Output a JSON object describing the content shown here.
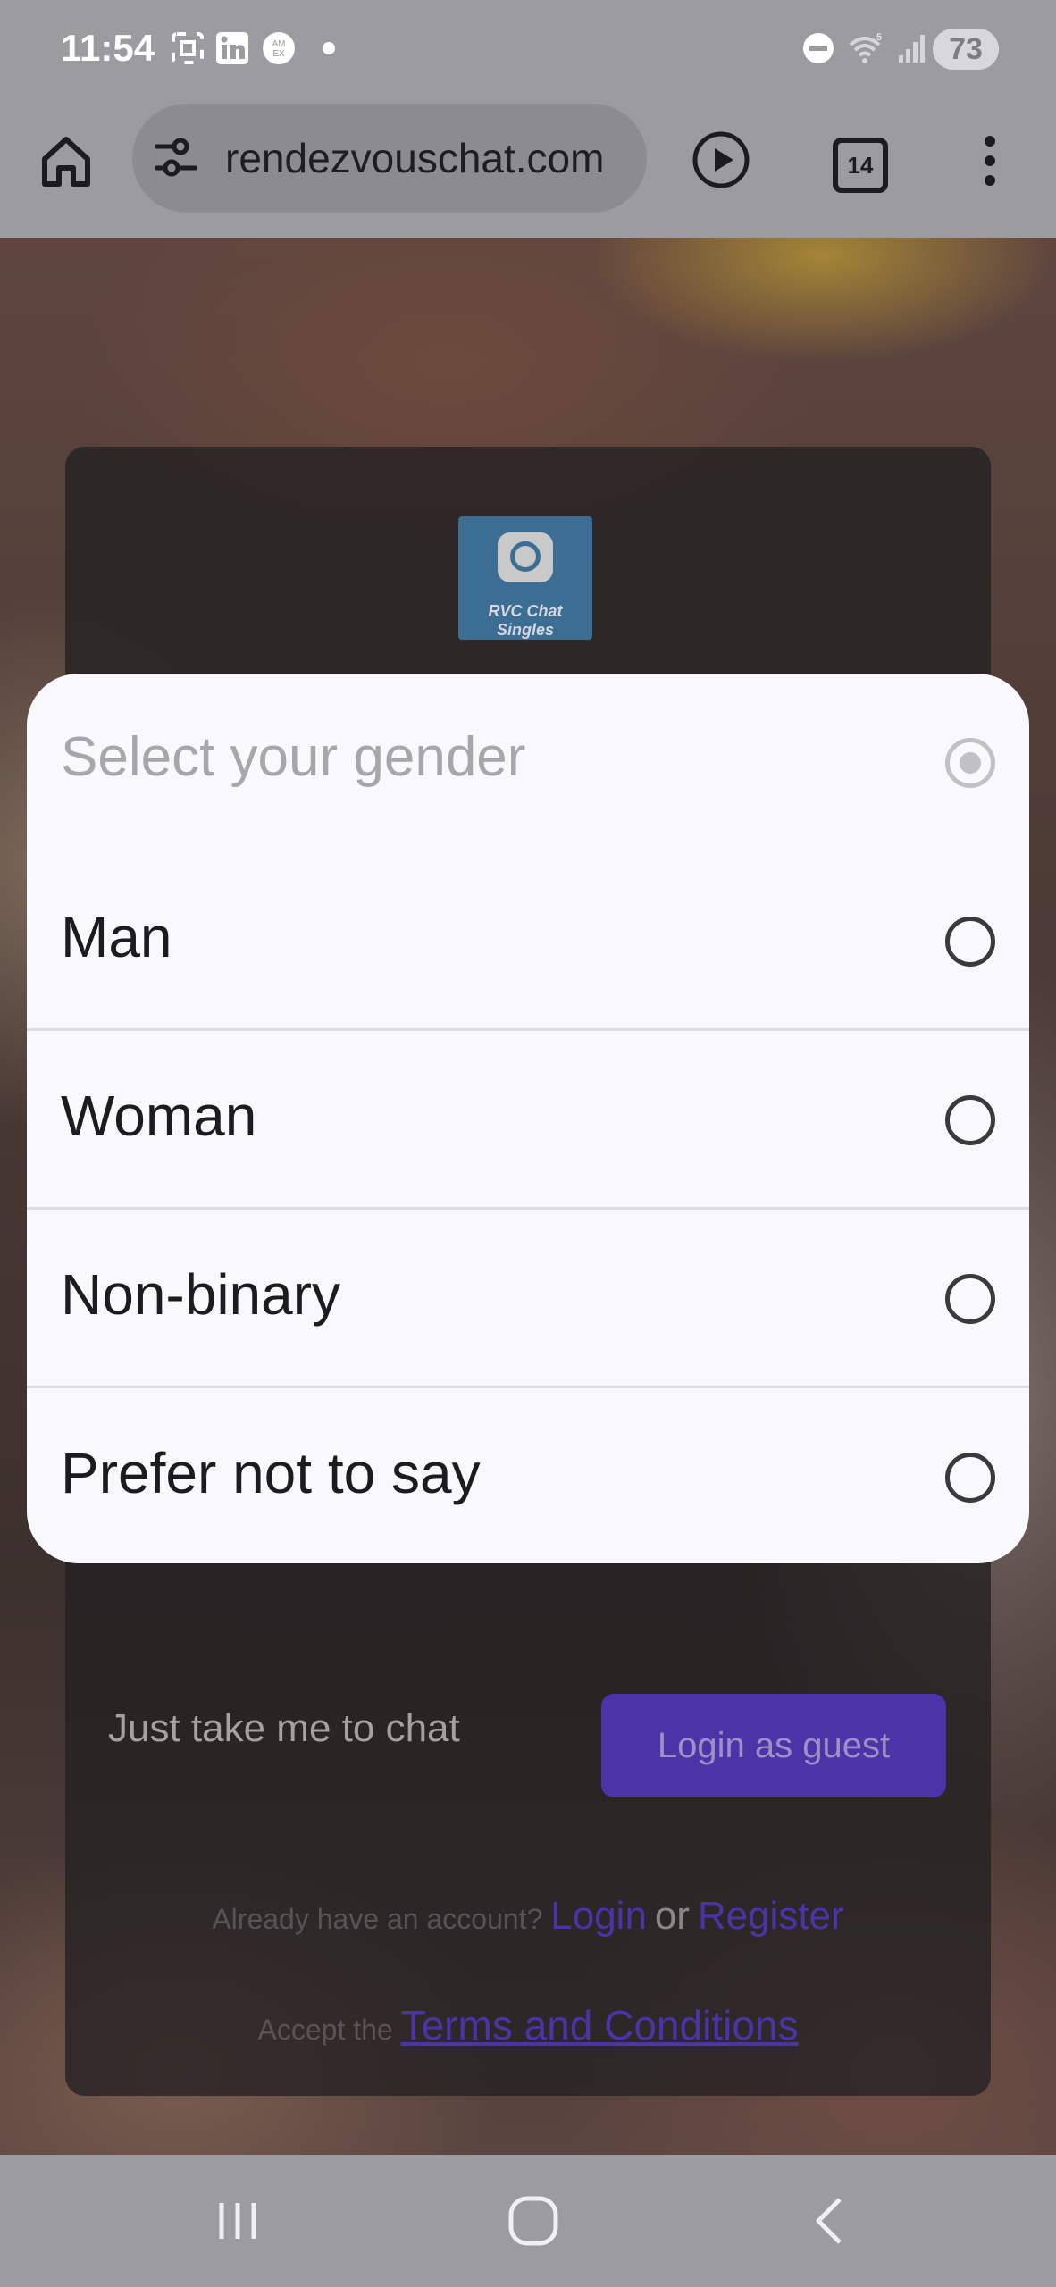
{
  "status_bar": {
    "time": "11:54",
    "battery": "73"
  },
  "browser": {
    "url": "rendezvouschat.com",
    "tab_count": "14"
  },
  "login_card": {
    "logo_text": "RVC Chat Singles",
    "guest_prompt": "Just take me to chat",
    "guest_button": "Login as guest",
    "account_prefix": "Already have an account?",
    "login_link": "Login",
    "or_text": "or",
    "register_link": "Register",
    "terms_prefix": "Accept the",
    "terms_link": "Terms and Conditions"
  },
  "gender_dialog": {
    "title": "Select your gender",
    "options": [
      {
        "label": "Man"
      },
      {
        "label": "Woman"
      },
      {
        "label": "Non-binary"
      },
      {
        "label": "Prefer not to say"
      }
    ]
  }
}
